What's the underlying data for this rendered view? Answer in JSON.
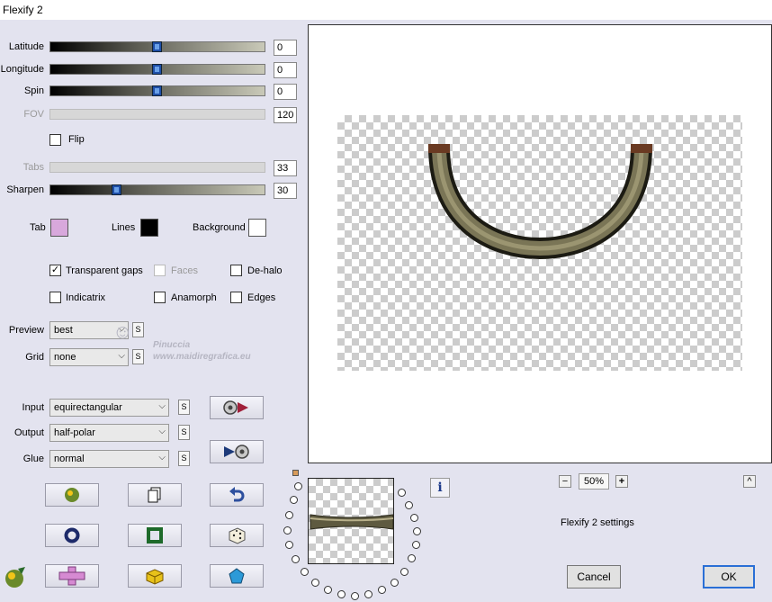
{
  "window": {
    "title": "Flexify 2"
  },
  "sliders": {
    "latitude": {
      "label": "Latitude",
      "value": "0",
      "level": 0.5
    },
    "longitude": {
      "label": "Longitude",
      "value": "0",
      "level": 0.5
    },
    "spin": {
      "label": "Spin",
      "value": "0",
      "level": 0.5
    },
    "fov": {
      "label": "FOV",
      "value": "120",
      "disabled": true
    },
    "tabs": {
      "label": "Tabs",
      "value": "33",
      "disabled": true
    },
    "sharpen": {
      "label": "Sharpen",
      "value": "30",
      "level": 0.31
    }
  },
  "flip": {
    "label": "Flip",
    "checked": false
  },
  "colors": {
    "tab": {
      "label": "Tab",
      "color": "#d8a8dc"
    },
    "lines": {
      "label": "Lines",
      "color": "#000000"
    },
    "background": {
      "label": "Background",
      "color": "#ffffff"
    }
  },
  "options": {
    "transparent_gaps": {
      "label": "Transparent gaps",
      "checked": true
    },
    "faces": {
      "label": "Faces",
      "checked": false,
      "disabled": true
    },
    "de_halo": {
      "label": "De-halo",
      "checked": false
    },
    "indicatrix": {
      "label": "Indicatrix",
      "checked": false
    },
    "anamorph": {
      "label": "Anamorph",
      "checked": false
    },
    "edges": {
      "label": "Edges",
      "checked": false
    }
  },
  "preview_select": {
    "label": "Preview",
    "value": "best"
  },
  "grid_select": {
    "label": "Grid",
    "value": "none"
  },
  "input_select": {
    "label": "Input",
    "value": "equirectangular"
  },
  "output_select": {
    "label": "Output",
    "value": "half-polar"
  },
  "glue_select": {
    "label": "Glue",
    "value": "normal"
  },
  "s_label": "S",
  "watermark": {
    "line1": "Pinuccia",
    "line2": "www.maidiregrafica.eu"
  },
  "zoom": {
    "minus": "−",
    "value": "50%",
    "plus": "+"
  },
  "settings_label": "Flexify 2 settings",
  "buttons": {
    "cancel": "Cancel",
    "ok": "OK"
  },
  "info_label": "i",
  "collapse_label": "^"
}
